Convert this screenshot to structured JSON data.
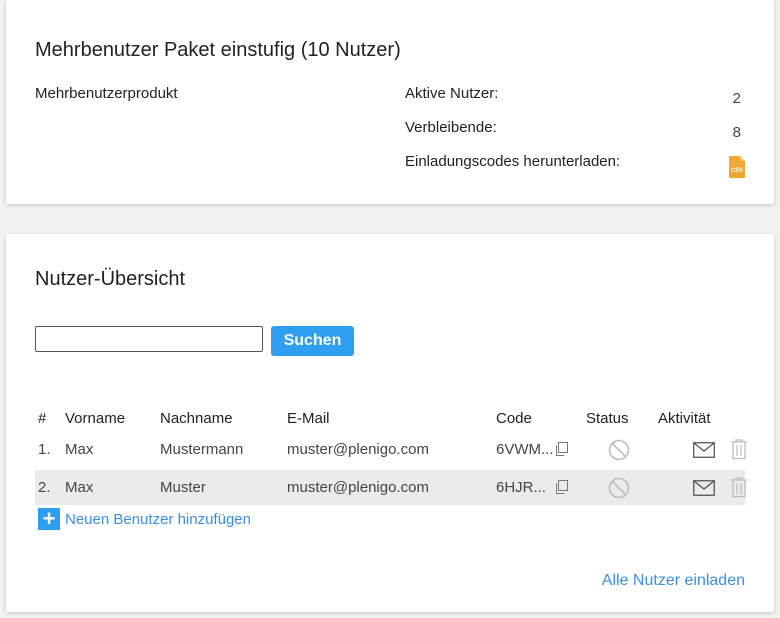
{
  "package": {
    "title": "Mehrbenutzer Paket einstufig (10 Nutzer)",
    "product_label": "Mehrbenutzerprodukt",
    "active_users_label": "Aktive Nutzer:",
    "active_users_value": "2",
    "remaining_label": "Verbleibende:",
    "remaining_value": "8",
    "download_codes_label": "Einladungscodes herunterladen:",
    "csv_icon_text": "CSV",
    "csv_icon": "csv-file-icon"
  },
  "overview": {
    "title": "Nutzer-Übersicht",
    "search_value": "",
    "search_button": "Suchen",
    "columns": {
      "index": "#",
      "firstname": "Vorname",
      "lastname": "Nachname",
      "email": "E-Mail",
      "code": "Code",
      "status": "Status",
      "activity": "Aktivität"
    },
    "rows": [
      {
        "index": "1.",
        "firstname": "Max",
        "lastname": "Mustermann",
        "email": "muster@plenigo.com",
        "code": "6VWM..."
      },
      {
        "index": "2.",
        "firstname": "Max",
        "lastname": "Muster",
        "email": "muster@plenigo.com",
        "code": "6HJR..."
      }
    ],
    "add_user_label": "Neuen Benutzer hinzufügen",
    "add_user_icon": "plus-icon",
    "invite_all_label": "Alle Nutzer einladen"
  },
  "colors": {
    "accent": "#2e9ef0",
    "link": "#3a8fe0",
    "csv_icon": "#f0a830",
    "row_alt": "#ebebeb"
  }
}
